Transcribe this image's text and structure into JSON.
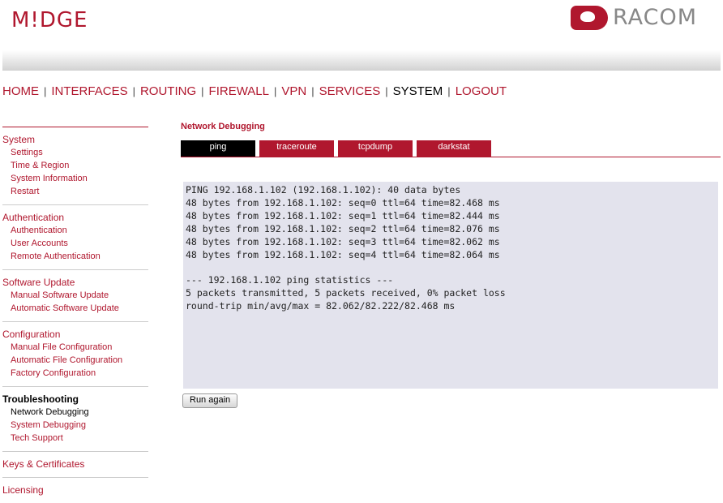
{
  "brand": {
    "left_logo": "M!DGE",
    "right_logo": "RACOM"
  },
  "nav": [
    {
      "label": "HOME",
      "active": false
    },
    {
      "label": "INTERFACES",
      "active": false
    },
    {
      "label": "ROUTING",
      "active": false
    },
    {
      "label": "FIREWALL",
      "active": false
    },
    {
      "label": "VPN",
      "active": false
    },
    {
      "label": "SERVICES",
      "active": false
    },
    {
      "label": "SYSTEM",
      "active": true
    },
    {
      "label": "LOGOUT",
      "active": false
    }
  ],
  "sidebar": {
    "groups": [
      {
        "title": "System",
        "items": [
          "Settings",
          "Time & Region",
          "System Information",
          "Restart"
        ]
      },
      {
        "title": "Authentication",
        "items": [
          "Authentication",
          "User Accounts",
          "Remote Authentication"
        ]
      },
      {
        "title": "Software Update",
        "items": [
          "Manual Software Update",
          "Automatic Software Update"
        ]
      },
      {
        "title": "Configuration",
        "items": [
          "Manual File Configuration",
          "Automatic File Configuration",
          "Factory Configuration"
        ]
      },
      {
        "title": "Troubleshooting",
        "items": [
          "Network Debugging",
          "System Debugging",
          "Tech Support"
        ]
      },
      {
        "title": "Keys & Certificates",
        "items": []
      },
      {
        "title": "Licensing",
        "items": []
      }
    ],
    "active_group": "Troubleshooting",
    "active_item": "Network Debugging"
  },
  "main": {
    "title": "Network Debugging",
    "tabs": [
      {
        "label": "ping",
        "active": true
      },
      {
        "label": "traceroute",
        "active": false
      },
      {
        "label": "tcpdump",
        "active": false
      },
      {
        "label": "darkstat",
        "active": false
      }
    ],
    "output_lines": [
      "PING 192.168.1.102 (192.168.1.102): 40 data bytes",
      "48 bytes from 192.168.1.102: seq=0 ttl=64 time=82.468 ms",
      "48 bytes from 192.168.1.102: seq=1 ttl=64 time=82.444 ms",
      "48 bytes from 192.168.1.102: seq=2 ttl=64 time=82.076 ms",
      "48 bytes from 192.168.1.102: seq=3 ttl=64 time=82.062 ms",
      "48 bytes from 192.168.1.102: seq=4 ttl=64 time=82.064 ms",
      "",
      "--- 192.168.1.102 ping statistics ---",
      "5 packets transmitted, 5 packets received, 0% packet loss",
      "round-trip min/avg/max = 82.062/82.222/82.468 ms"
    ],
    "run_button": "Run again"
  },
  "colors": {
    "brand_red": "#b0172e",
    "output_bg": "#e3e3ed"
  }
}
